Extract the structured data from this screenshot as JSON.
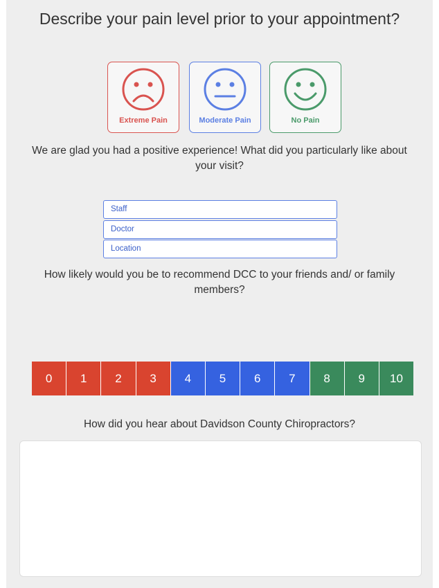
{
  "question_pain": "Describe your pain level prior to your appointment?",
  "faces": [
    {
      "label": "Extreme Pain",
      "icon": "sad-face-icon",
      "color": "#d9534f"
    },
    {
      "label": "Moderate Pain",
      "icon": "neutral-face-icon",
      "color": "#5b7fe3"
    },
    {
      "label": "No Pain",
      "icon": "happy-face-icon",
      "color": "#4a9a6a"
    }
  ],
  "question_like": "We are glad you had a positive experience! What did you particularly like about your visit?",
  "like_options": [
    "Staff",
    "Doctor",
    "Location"
  ],
  "question_recommend": "How likely would you be to recommend DCC to your friends and/ or family members?",
  "scale": {
    "values": [
      "0",
      "1",
      "2",
      "3",
      "4",
      "5",
      "6",
      "7",
      "8",
      "9",
      "10"
    ],
    "colors": {
      "low": "#d9442f",
      "mid": "#3562e0",
      "high": "#3a8a5c"
    }
  },
  "question_hear": "How did you hear about Davidson County Chiropractors?",
  "hear_textbox_value": ""
}
